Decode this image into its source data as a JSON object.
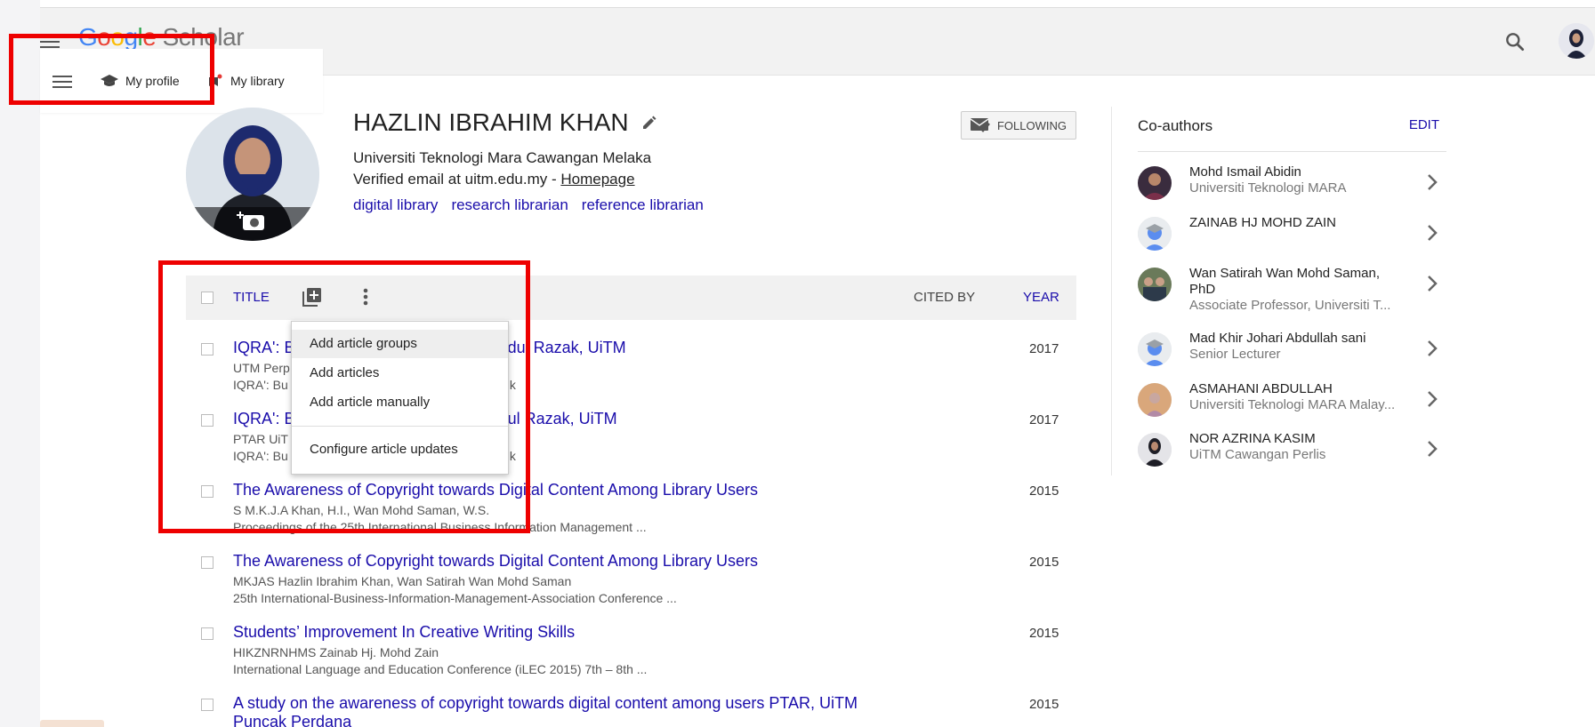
{
  "app": {
    "logo_letters": [
      "G",
      "o",
      "o",
      "g",
      "l",
      "e"
    ],
    "logo_rest": " Scholar"
  },
  "menu": {
    "my_profile": "My profile",
    "my_library": "My library"
  },
  "profile": {
    "name": "HAZLIN IBRAHIM KHAN",
    "affiliation": "Universiti Teknologi Mara Cawangan Melaka",
    "email_text": "Verified email at uitm.edu.my - ",
    "homepage": "Homepage",
    "tags": [
      "digital library",
      "research librarian",
      "reference librarian"
    ],
    "follow_label": "FOLLOWING"
  },
  "table": {
    "title_label": "TITLE",
    "cited_by_label": "CITED BY",
    "year_label": "YEAR"
  },
  "dropdown": {
    "items": [
      "Add article groups",
      "Add articles",
      "Add article manually"
    ],
    "configure": "Configure article updates"
  },
  "articles": [
    {
      "title": "IQRA': Business",
      "title_tail": "akaan Tun Abdul Razak, UiTM",
      "authors": "UTM Perp",
      "venue": "IQRA': Bu",
      "venue_tail": "k",
      "year": "2017"
    },
    {
      "title": "IQRA': Business",
      "title_tail": "kaan Tun Abdul Razak, UiTM",
      "authors": "PTAR UiT",
      "venue": "IQRA': Bu",
      "venue_tail": "k",
      "year": "2017"
    },
    {
      "title": "The Awareness of Copyright towards Digital Content Among Library Users",
      "authors": "S M.K.J.A Khan, H.I., Wan Mohd Saman, W.S.",
      "venue": "Proceedings of the 25th International Business Information Management ...",
      "year": "2015"
    },
    {
      "title": "The Awareness of Copyright towards Digital Content Among Library Users",
      "authors": "MKJAS Hazlin Ibrahim Khan, Wan Satirah Wan Mohd Saman",
      "venue": "25th International-Business-Information-Management-Association Conference ...",
      "year": "2015"
    },
    {
      "title": "Students’ Improvement In Creative Writing Skills",
      "authors": "HIKZNRNHMS Zainab Hj. Mohd Zain",
      "venue": "International Language and Education Conference (iLEC 2015) 7th – 8th ...",
      "year": "2015"
    },
    {
      "title": "A study on the awareness of copyright towards digital content among users PTAR, UiTM",
      "title_line2": "Puncak Perdana",
      "year": "2015"
    }
  ],
  "coauthors": {
    "title": "Co-authors",
    "edit": "EDIT",
    "list": [
      {
        "name": "Mohd Ismail Abidin",
        "affiliation": "Universiti Teknologi MARA",
        "avatar": "photo"
      },
      {
        "name": "ZAINAB HJ MOHD ZAIN",
        "affiliation": "",
        "avatar": "default"
      },
      {
        "name": "Wan Satirah Wan Mohd Saman, PhD",
        "affiliation": "Associate Professor, Universiti T...",
        "avatar": "photo"
      },
      {
        "name": "Mad Khir Johari Abdullah sani",
        "affiliation": "Senior Lecturer",
        "avatar": "default"
      },
      {
        "name": "ASMAHANI ABDULLAH",
        "affiliation": "Universiti Teknologi MARA Malay...",
        "avatar": "photo"
      },
      {
        "name": "NOR AZRINA KASIM",
        "affiliation": "UiTM Cawangan Perlis",
        "avatar": "photo"
      }
    ]
  },
  "colors": {
    "link": "#1a0dab",
    "highlight": "#ee0000"
  }
}
